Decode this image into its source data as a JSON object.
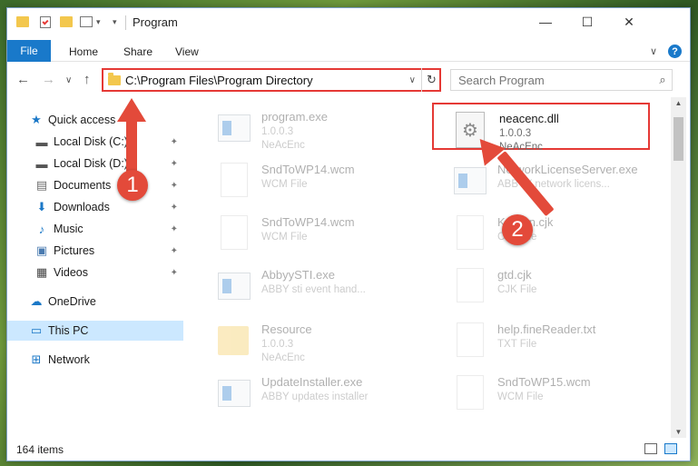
{
  "window": {
    "title": "Program",
    "controls": {
      "minimize": "—",
      "maximize": "☐",
      "close": "✕"
    }
  },
  "ribbon": {
    "file_tab": "File",
    "tabs": [
      "Home",
      "Share",
      "View"
    ],
    "collapse": "∨",
    "help": "?"
  },
  "nav": {
    "back": "←",
    "forward": "→",
    "recent": "∨",
    "up": "↑",
    "address": "C:\\Program Files\\Program Directory",
    "address_dropdown": "∨",
    "refresh": "↻",
    "search_placeholder": "Search Program",
    "search_icon": "⌕"
  },
  "sidebar": {
    "items": [
      {
        "label": "Quick access",
        "icon": "star-icon",
        "glyph": "★",
        "color": "#1b78c7",
        "pinned": false,
        "selected": false
      },
      {
        "label": "Local Disk (C:)",
        "icon": "drive-icon",
        "glyph": "▬",
        "color": "#555555",
        "pinned": true,
        "selected": false
      },
      {
        "label": "Local Disk (D:)",
        "icon": "drive-icon",
        "glyph": "▬",
        "color": "#555555",
        "pinned": true,
        "selected": false
      },
      {
        "label": "Documents",
        "icon": "documents-icon",
        "glyph": "▤",
        "color": "#6d6d6d",
        "pinned": true,
        "selected": false
      },
      {
        "label": "Downloads",
        "icon": "download-icon",
        "glyph": "⬇",
        "color": "#1b78c7",
        "pinned": true,
        "selected": false
      },
      {
        "label": "Music",
        "icon": "music-icon",
        "glyph": "♪",
        "color": "#1b78c7",
        "pinned": true,
        "selected": false
      },
      {
        "label": "Pictures",
        "icon": "pictures-icon",
        "glyph": "▣",
        "color": "#4a7bb0",
        "pinned": true,
        "selected": false
      },
      {
        "label": "Videos",
        "icon": "videos-icon",
        "glyph": "▦",
        "color": "#444444",
        "pinned": true,
        "selected": false
      },
      {
        "label": "OneDrive",
        "icon": "cloud-icon",
        "glyph": "☁",
        "color": "#1b78c7",
        "pinned": false,
        "selected": false
      },
      {
        "label": "This PC",
        "icon": "computer-icon",
        "glyph": "▭",
        "color": "#1b78c7",
        "pinned": false,
        "selected": true
      },
      {
        "label": "Network",
        "icon": "network-icon",
        "glyph": "⊞",
        "color": "#1b78c7",
        "pinned": false,
        "selected": false
      }
    ],
    "pin_glyph": "📌"
  },
  "files": [
    {
      "name": "program.exe",
      "line1": "1.0.0.3",
      "line2": "NeAcEnc",
      "kind": "exe-icon",
      "highlighted": false,
      "faded": true
    },
    {
      "name": "neacenc.dll",
      "line1": "1.0.0.3",
      "line2": "NeAcEnc",
      "kind": "dll-gears-icon",
      "highlighted": true,
      "faded": false
    },
    {
      "name": "SndToWP14.wcm",
      "line1": "WCM File",
      "line2": "",
      "kind": "document-icon",
      "highlighted": false,
      "faded": true
    },
    {
      "name": "NetworkLicenseServer.exe",
      "line1": "ABBYY network licens...",
      "line2": "",
      "kind": "exe-icon",
      "highlighted": false,
      "faded": true
    },
    {
      "name": "SndToWP14.wcm",
      "line1": "WCM File",
      "line2": "",
      "kind": "document-icon",
      "highlighted": false,
      "faded": true
    },
    {
      "name": "Korean.cjk",
      "line1": "CJK File",
      "line2": "",
      "kind": "document-icon",
      "highlighted": false,
      "faded": true
    },
    {
      "name": "AbbyySTI.exe",
      "line1": "ABBY sti event hand...",
      "line2": "",
      "kind": "exe-icon",
      "highlighted": false,
      "faded": true
    },
    {
      "name": "gtd.cjk",
      "line1": "CJK File",
      "line2": "",
      "kind": "document-icon",
      "highlighted": false,
      "faded": true
    },
    {
      "name": "Resource",
      "line1": "1.0.0.3",
      "line2": "NeAcEnc",
      "kind": "folder-icon",
      "highlighted": false,
      "faded": true
    },
    {
      "name": "help.fineReader.txt",
      "line1": "TXT File",
      "line2": "",
      "kind": "document-icon",
      "highlighted": false,
      "faded": true
    },
    {
      "name": "UpdateInstaller.exe",
      "line1": "ABBY updates installer",
      "line2": "",
      "kind": "exe-icon",
      "highlighted": false,
      "faded": true
    },
    {
      "name": "SndToWP15.wcm",
      "line1": "WCM File",
      "line2": "",
      "kind": "document-icon",
      "highlighted": false,
      "faded": true
    }
  ],
  "status": {
    "item_count": "164 items"
  },
  "annotations": [
    {
      "label": "1",
      "color": "#e34a3a"
    },
    {
      "label": "2",
      "color": "#e34a3a"
    }
  ]
}
